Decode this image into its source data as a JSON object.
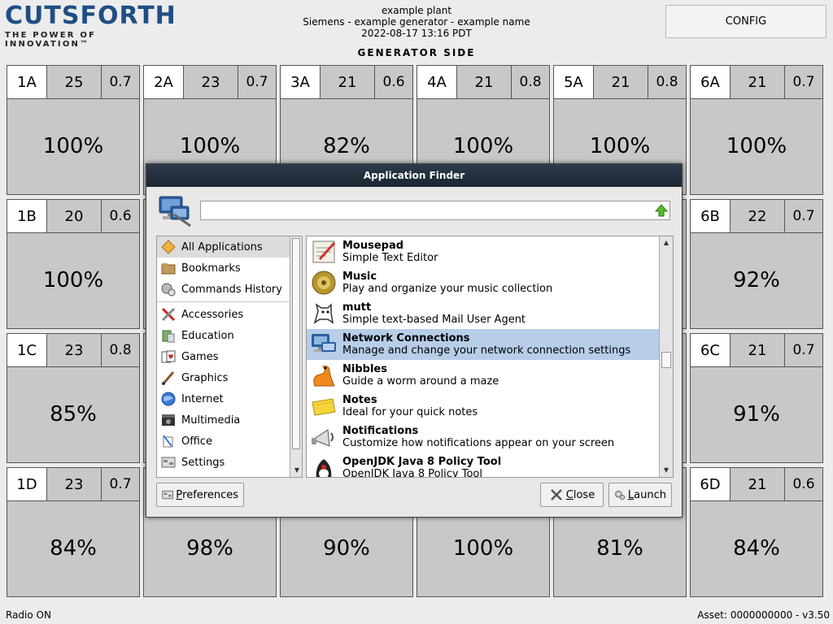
{
  "header": {
    "logo_word": "CUTSFORTH",
    "logo_tagline": "THE POWER OF INNOVATION™",
    "plant": "example plant",
    "generator": "Siemens - example generator - example name",
    "timestamp": "2022-08-17 13:16 PDT",
    "config_label": "CONFIG",
    "side_label": "GENERATOR SIDE"
  },
  "grid": [
    {
      "id": "1A",
      "v1": "25",
      "v2": "0.7",
      "pct": "100%"
    },
    {
      "id": "2A",
      "v1": "23",
      "v2": "0.7",
      "pct": "100%"
    },
    {
      "id": "3A",
      "v1": "21",
      "v2": "0.6",
      "pct": "82%"
    },
    {
      "id": "4A",
      "v1": "21",
      "v2": "0.8",
      "pct": "100%"
    },
    {
      "id": "5A",
      "v1": "21",
      "v2": "0.8",
      "pct": "100%"
    },
    {
      "id": "6A",
      "v1": "21",
      "v2": "0.7",
      "pct": "100%"
    },
    {
      "id": "1B",
      "v1": "20",
      "v2": "0.6",
      "pct": "100%"
    },
    {
      "id": "6B",
      "v1": "22",
      "v2": "0.7",
      "pct": "92%"
    },
    {
      "id": "1C",
      "v1": "23",
      "v2": "0.8",
      "pct": "85%"
    },
    {
      "id": "6C",
      "v1": "21",
      "v2": "0.7",
      "pct": "91%"
    },
    {
      "id": "1D",
      "v1": "23",
      "v2": "0.7",
      "pct": "84%"
    },
    {
      "id": "6D",
      "v1": "21",
      "v2": "0.6",
      "pct": "84%"
    },
    {
      "pct": "98%"
    },
    {
      "pct": "90%"
    },
    {
      "pct": "100%"
    },
    {
      "pct": "81%"
    }
  ],
  "footer": {
    "radio": "Radio ON",
    "asset": "Asset: 0000000000 - v3.50"
  },
  "dialog": {
    "title": "Application Finder",
    "search_value": "",
    "categories": [
      {
        "label": "All Applications",
        "icon": "all-apps-icon",
        "selected": true
      },
      {
        "label": "Bookmarks",
        "icon": "bookmarks-icon"
      },
      {
        "label": "Commands History",
        "icon": "history-icon"
      },
      {
        "label": "Accessories",
        "icon": "accessories-icon"
      },
      {
        "label": "Education",
        "icon": "education-icon"
      },
      {
        "label": "Games",
        "icon": "games-icon"
      },
      {
        "label": "Graphics",
        "icon": "graphics-icon"
      },
      {
        "label": "Internet",
        "icon": "internet-icon"
      },
      {
        "label": "Multimedia",
        "icon": "multimedia-icon"
      },
      {
        "label": "Office",
        "icon": "office-icon"
      },
      {
        "label": "Settings",
        "icon": "settings-icon"
      }
    ],
    "apps": [
      {
        "name": "Mousepad",
        "desc": "Simple Text Editor",
        "icon": "mousepad-icon"
      },
      {
        "name": "Music",
        "desc": "Play and organize your music collection",
        "icon": "music-icon"
      },
      {
        "name": "mutt",
        "desc": "Simple text-based Mail User Agent",
        "icon": "mutt-icon"
      },
      {
        "name": "Network Connections",
        "desc": "Manage and change your network connection settings",
        "icon": "network-icon",
        "selected": true
      },
      {
        "name": "Nibbles",
        "desc": "Guide a worm around a maze",
        "icon": "nibbles-icon"
      },
      {
        "name": "Notes",
        "desc": "Ideal for your quick notes",
        "icon": "notes-icon"
      },
      {
        "name": "Notifications",
        "desc": "Customize how notifications appear on your screen",
        "icon": "notifications-icon"
      },
      {
        "name": "OpenJDK Java 8 Policy Tool",
        "desc": "OpenJDK Java 8 Policy Tool",
        "icon": "java-icon"
      }
    ],
    "buttons": {
      "preferences_first": "P",
      "preferences_rest": "references",
      "close_first": "C",
      "close_rest": "lose",
      "launch_first": "L",
      "launch_rest": "aunch"
    }
  }
}
